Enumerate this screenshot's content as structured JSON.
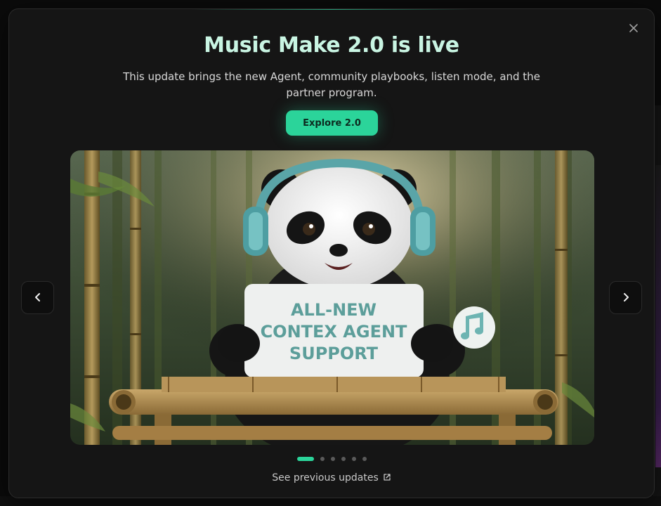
{
  "modal": {
    "title": "Music Make 2.0 is live",
    "subtitle": "This update brings the new Agent, community playbooks, listen mode, and the partner program.",
    "cta_label": "Explore 2.0",
    "close_icon": "close-icon",
    "previous_updates_label": "See previous updates"
  },
  "carousel": {
    "slide_sign_lines": [
      "ALL-NEW",
      "CONTEX AGENT",
      "SUPPORT"
    ],
    "active_index": 0,
    "slide_count": 6
  },
  "colors": {
    "accent": "#2bd49a",
    "title": "#c9f5e3",
    "modal_bg": "#151515"
  }
}
